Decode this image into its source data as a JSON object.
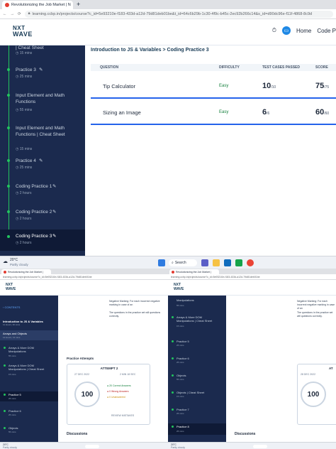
{
  "browser": {
    "tab_title": "Revolutionizing the Job Market | N",
    "url": "learning.ccbp.in/projects/course?c_id=5e93210e-f183-433d-a12d-79d81deb01be&t_id=64c6b29b-1c30-4f9c-b45c-2ec92b266c14&s_id=d90dc96e-f11f-4868-8c9d"
  },
  "header": {
    "logo_top": "NXT",
    "logo_bottom": "WAVE",
    "home_label": "Home",
    "code_label": "Code P"
  },
  "sidebar": {
    "items": [
      {
        "label": "| Cheat Sheet",
        "time": "15 mins"
      },
      {
        "label": "Practice 3",
        "time": "25 mins"
      },
      {
        "label": "Input Element and Math Functions",
        "time": "55 mins"
      },
      {
        "label": "Input Element and Math Functions | Cheat Sheet",
        "time": "15 mins"
      },
      {
        "label": "Practice 4",
        "time": "25 mins"
      },
      {
        "label": "Coding Practice 1",
        "time": "2 hours"
      },
      {
        "label": "Coding Practice 2",
        "time": "2 hours"
      },
      {
        "label": "Coding Practice 3",
        "time": "2 hours"
      }
    ]
  },
  "main": {
    "breadcrumb": "Introduction to JS & Variables > Coding Practice 3",
    "columns": [
      "QUESTION",
      "DIFFICULTY",
      "TEST CASES PASSED",
      "SCORE"
    ],
    "rows": [
      {
        "question": "Tip Calculator",
        "difficulty": "Easy",
        "passed": "10",
        "total": "/10",
        "score": "75",
        "score_total": "/75"
      },
      {
        "question": "Sizing an Image",
        "difficulty": "Easy",
        "passed": "6",
        "total": "/6",
        "score": "60",
        "score_total": "/60"
      }
    ]
  },
  "taskbar": {
    "temp": "20°C",
    "weather": "Partly cloudy",
    "search": "Search"
  },
  "left_panel": {
    "tab": "Revolutionizing the Job Market |",
    "url": "learning.ccbp.in/projects/course?c_id=5e93210e-f183-433d-a12d-79d81deb01be",
    "contents": "CONTENTS",
    "section": "Introduction to JS & Variables",
    "section_meta": "11 Hours, 30 mins",
    "sub_section": "Arrays and Objects",
    "sub_meta": "12 Hours, 13 mins",
    "items": [
      {
        "label": "Arrays & More DOM Manipulations",
        "time": "55 mins"
      },
      {
        "label": "Arrays & More DOM Manipulations | Cheat Sheet",
        "time": "15 mins"
      },
      {
        "label": "Practice 5",
        "time": "25 mins"
      },
      {
        "label": "Practice 6",
        "time": "25 mins"
      },
      {
        "label": "Objects",
        "time": "55 mins"
      }
    ],
    "notes": [
      "Negative Marking: For each incorrect negative marking in case of an",
      "The questions in the practice set will questions correctly."
    ],
    "practice_attempts": "Practice Attempts",
    "attempt_label": "ATTEMPT 2",
    "attempt_date": "27 DEC 2022",
    "attempt_time": "2 MIN 18 SEC",
    "score": "100",
    "correct": "20 Correct Answers",
    "wrong": "0 Wrong Answers",
    "unanswered": "0 Unanswered",
    "review": "REVIEW MISTAKES",
    "discussions": "Discussions"
  },
  "right_panel": {
    "items": [
      {
        "label": "Manipulations",
        "time": "55 mins"
      },
      {
        "label": "Arrays & More DOM Manipulations | Cheat Sheet",
        "time": "15 mins"
      },
      {
        "label": "Practice 5",
        "time": "25 mins"
      },
      {
        "label": "Practice 6",
        "time": "25 mins"
      },
      {
        "label": "Objects",
        "time": "55 mins"
      },
      {
        "label": "Objects | Cheat Sheet",
        "time": "15 mins"
      },
      {
        "label": "Practice 7",
        "time": "25 mins"
      },
      {
        "label": "Practice 8",
        "time": "25 mins"
      }
    ],
    "attempt_label": "AT",
    "attempt_date": "28 DEC 2022",
    "score": "100",
    "discussions": "Discussions"
  },
  "colors": {
    "sidebar": "#1b2a4e",
    "accent": "#2563eb",
    "easy": "#15803d",
    "progress": "#22c55e"
  }
}
